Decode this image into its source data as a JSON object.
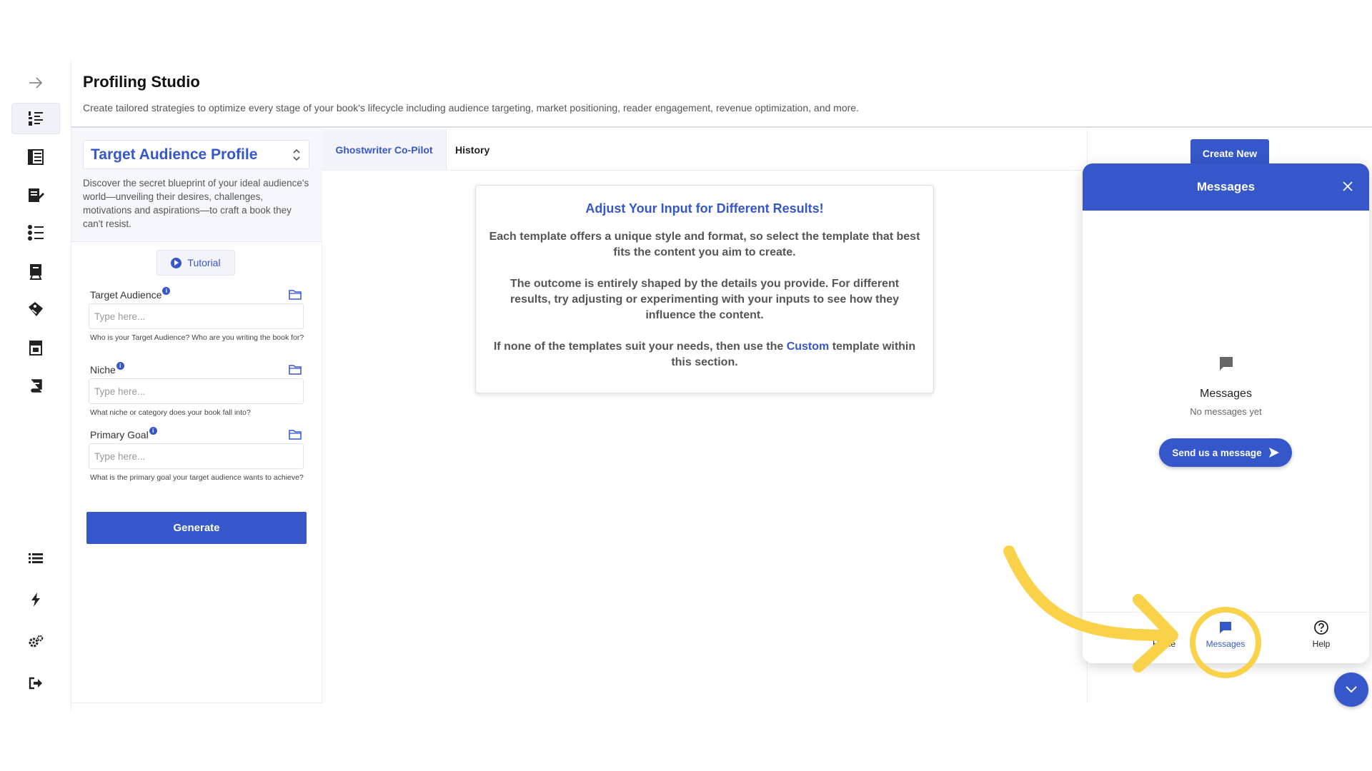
{
  "sidebar": {
    "items": [
      {
        "icon": "arrow-right-icon"
      },
      {
        "icon": "numbered-list-icon",
        "active": true
      },
      {
        "icon": "book-layout-icon"
      },
      {
        "icon": "book-edit-icon"
      },
      {
        "icon": "checklist-icon"
      },
      {
        "icon": "book-stand-icon"
      },
      {
        "icon": "book-tag-icon"
      },
      {
        "icon": "storefront-icon"
      },
      {
        "icon": "book-icon"
      },
      {
        "icon": "list-icon"
      },
      {
        "icon": "lightning-icon"
      },
      {
        "icon": "gears-icon"
      },
      {
        "icon": "logout-icon"
      }
    ]
  },
  "header": {
    "title": "Profiling Studio",
    "subtitle": "Create tailored strategies to optimize every stage of your book's lifecycle including audience targeting, market positioning, reader engagement, revenue optimization, and more."
  },
  "config": {
    "template": "Target Audience Profile",
    "description": "Discover the secret blueprint of your ideal audience's world—unveiling their desires, challenges, motivations and aspirations—to craft a book they can't resist.",
    "tutorial_label": "Tutorial",
    "fields": [
      {
        "label": "Target Audience",
        "placeholder": "Type here...",
        "help": "Who is your Target Audience? Who are you writing the book for?"
      },
      {
        "label": "Niche",
        "placeholder": "Type here...",
        "help": "What niche or category does your book fall into?"
      },
      {
        "label": "Primary Goal",
        "placeholder": "Type here...",
        "help": "What is the primary goal your target audience wants to achieve?"
      }
    ],
    "generate_label": "Generate"
  },
  "tabs": [
    {
      "label": "Ghostwriter Co-Pilot",
      "active": true
    },
    {
      "label": "History",
      "active": false
    }
  ],
  "info_card": {
    "title": "Adjust Your Input for Different Results!",
    "p1": "Each template offers a unique style and format, so select the template that best fits the content you aim to create.",
    "p2": "The outcome is entirely shaped by the details you provide. For different results, try adjusting or experimenting with your inputs to see how they influence the content.",
    "p3_before": "If none of the templates suit your needs, then use the ",
    "p3_link": "Custom",
    "p3_after": " template within this section."
  },
  "create_new_label": "Create New",
  "messages_widget": {
    "title": "Messages",
    "empty_title": "Messages",
    "empty_sub": "No messages yet",
    "send_label": "Send us a message",
    "nav": [
      {
        "label": "Home",
        "active": false
      },
      {
        "label": "Messages",
        "active": true
      },
      {
        "label": "Help",
        "active": false
      }
    ]
  },
  "colors": {
    "accent": "#3557c9",
    "annotation": "#f9d24a"
  }
}
